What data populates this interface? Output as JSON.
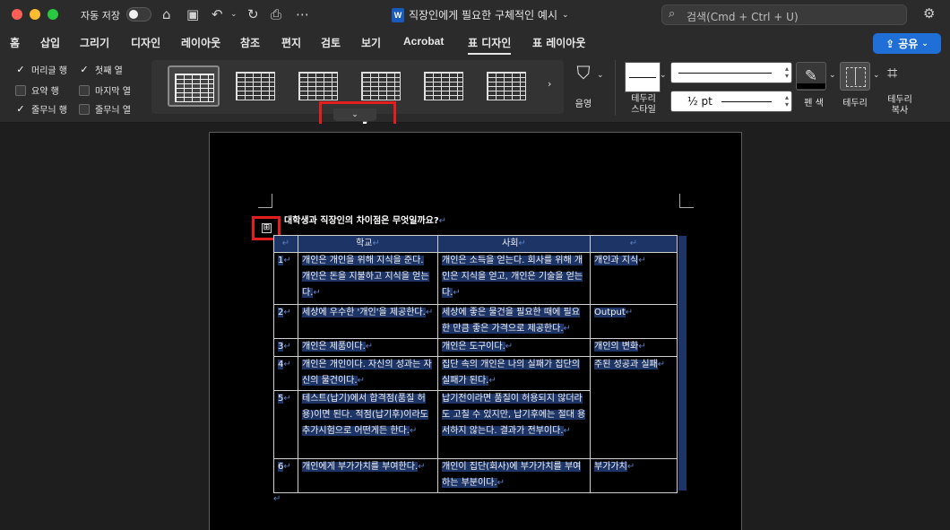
{
  "titlebar": {
    "autosave_label": "자동 저장",
    "doc_title": "직장인에게 필요한 구체적인 예시",
    "search_placeholder": "검색(Cmd + Ctrl + U)"
  },
  "tabs": [
    "홈",
    "삽입",
    "그리기",
    "디자인",
    "레이아웃",
    "참조",
    "편지",
    "검토",
    "보기",
    "Acrobat",
    "표 디자인",
    "표 레이아웃"
  ],
  "active_tab": "표 디자인",
  "share_label": "공유",
  "style_options": [
    {
      "label": "머리글 행",
      "checked": true
    },
    {
      "label": "첫째 열",
      "checked": true
    },
    {
      "label": "요약 행",
      "checked": false
    },
    {
      "label": "마지막 열",
      "checked": false
    },
    {
      "label": "줄무늬 행",
      "checked": true
    },
    {
      "label": "줄무늬 열",
      "checked": false
    }
  ],
  "ribbon": {
    "shading_label": "음영",
    "border_style_label": "테두리\n스타일",
    "pen_weight": "½ pt",
    "pen_color_label": "펜 색",
    "borders_label": "테두리",
    "border_painter_label": "테두리\n복사"
  },
  "document": {
    "question": "대학생과 직장인의 차이점은 무엇일까요?",
    "table": {
      "headers": [
        "",
        "학교",
        "사회",
        ""
      ],
      "rows": [
        {
          "num": "1",
          "school": "개인은 개인을 위해 지식을 준다. 개인은 돈을 지불하고 지식을 얻는다.",
          "society": "개인은 소득을 얻는다. 회사를 위해 개인은 지식을 얻고, 개인은 기술을 얻는다.",
          "key": "개인과 지식"
        },
        {
          "num": "2",
          "school": "세상에 우수한 '개인'을 제공한다.",
          "society": "세상에 좋은 물건을 필요한 때에 필요한 만큼 좋은 가격으로 제공한다.",
          "key": "Output"
        },
        {
          "num": "3",
          "school": "개인은 제품이다.",
          "society": "개인은 도구이다.",
          "key": "개인의 변화"
        },
        {
          "num": "4",
          "school": "개인은 개인이다. 자신의 성과는 자신의 물건이다.",
          "society": "집단 속의 개인은 나의 실패가 집단의 실패가 된다.",
          "key": "주된 성공과 실패"
        },
        {
          "num": "5",
          "school": "테스트(납기)에서 합격점(품질 허용)이면 된다. 적점(납기후)이라도 추가시험으로 어떤게든 한다.",
          "society": "납기전이라면 품질이 허용되지 않더라도 고칠 수 있지만, 납기후에는 절대 용서하지 않는다. 결과가 전부이다.",
          "key": ""
        },
        {
          "num": "6",
          "school": "개인에게 부가가치를 부여한다.",
          "society": "개인이 집단(회사)에 부가가치를 부여하는 부분이다.",
          "key": "부가가치"
        }
      ]
    }
  },
  "colors": {
    "accent": "#1f6fd6",
    "highlight": "#e41e1e",
    "selection": "#1d3466"
  }
}
